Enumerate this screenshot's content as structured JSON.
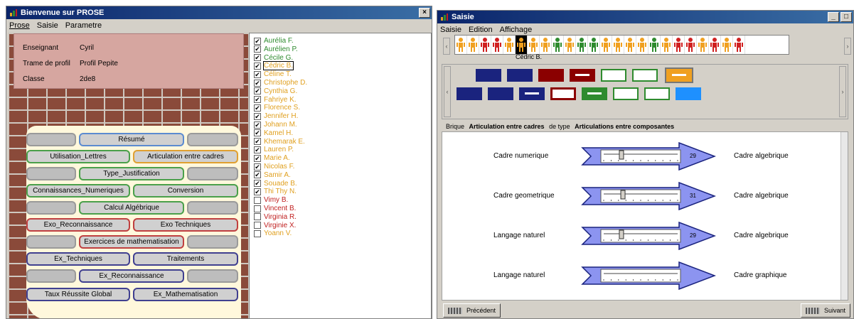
{
  "left_window": {
    "title": "Bienvenue sur PROSE",
    "menu": [
      "Prose",
      "Saisie",
      "Parametre"
    ],
    "info": [
      {
        "label": "Enseignant",
        "value": "Cyril"
      },
      {
        "label": "Trame de profil",
        "value": "Profil Pepite"
      },
      {
        "label": "Classe",
        "value": "2de8"
      }
    ],
    "buttons": {
      "resume": "Résumé",
      "utilisation_lettres": "Utilisation_Lettres",
      "articulation_cadres": "Articulation entre cadres",
      "type_justification": "Type_Justification",
      "connaissances": "Connaissances_Numeriques",
      "conversion": "Conversion",
      "calcul": "Calcul Algébrique",
      "exo_reconnaissance": "Exo_Reconnaissance",
      "exo_techniques": "Exo Techniques",
      "exercices_math": "Exercices de mathematisation",
      "ex_techniques": "Ex_Techniques",
      "traitements": "Traitements",
      "ex_reconnaissance": "Ex_Reconnaissance",
      "taux": "Taux Réussite Global",
      "ex_math": "Ex_Mathematisation"
    },
    "students": [
      {
        "name": "Aurélia F.",
        "checked": true,
        "color": "#2e8b2e"
      },
      {
        "name": "Aurélien P.",
        "checked": true,
        "color": "#2e8b2e"
      },
      {
        "name": "Cécile G.",
        "checked": true,
        "color": "#2e8b2e"
      },
      {
        "name": "Cédric B.",
        "checked": true,
        "color": "#e0a020"
      },
      {
        "name": "Céline T.",
        "checked": true,
        "color": "#e0a020"
      },
      {
        "name": "Christophe D.",
        "checked": true,
        "color": "#e0a020"
      },
      {
        "name": "Cynthia G.",
        "checked": true,
        "color": "#e0a020"
      },
      {
        "name": "Fahriye K.",
        "checked": true,
        "color": "#e0a020"
      },
      {
        "name": "Florence S.",
        "checked": true,
        "color": "#e0a020"
      },
      {
        "name": "Jennifer H.",
        "checked": true,
        "color": "#e0a020"
      },
      {
        "name": "Johann M.",
        "checked": true,
        "color": "#e0a020"
      },
      {
        "name": "Kamel H.",
        "checked": true,
        "color": "#e0a020"
      },
      {
        "name": "Khemarak E.",
        "checked": true,
        "color": "#e0a020"
      },
      {
        "name": "Lauren P.",
        "checked": true,
        "color": "#e0a020"
      },
      {
        "name": "Marie A.",
        "checked": true,
        "color": "#e0a020"
      },
      {
        "name": "Nicolas F.",
        "checked": true,
        "color": "#e0a020"
      },
      {
        "name": "Samir A.",
        "checked": true,
        "color": "#e0a020"
      },
      {
        "name": "Souade B.",
        "checked": true,
        "color": "#e0a020"
      },
      {
        "name": "Thi Thy N.",
        "checked": true,
        "color": "#e0a020"
      },
      {
        "name": "Vimy B.",
        "checked": false,
        "color": "#c02020"
      },
      {
        "name": "Vincent B.",
        "checked": false,
        "color": "#c02020"
      },
      {
        "name": "Virginia R.",
        "checked": false,
        "color": "#c02020"
      },
      {
        "name": "Virginie X.",
        "checked": false,
        "color": "#c02020"
      },
      {
        "name": "Yoann V.",
        "checked": false,
        "color": "#e0a020"
      }
    ]
  },
  "right_window": {
    "title": "Saisie",
    "menu": [
      "Saisie",
      "Edition",
      "Affichage"
    ],
    "selected_student": "Cédric B.",
    "figures": [
      "orange",
      "orange",
      "red",
      "red",
      "orange",
      "selected",
      "orange",
      "orange",
      "green",
      "orange",
      "green",
      "green",
      "orange",
      "orange",
      "orange",
      "orange",
      "green",
      "orange",
      "red",
      "red",
      "orange",
      "red",
      "orange",
      "red"
    ],
    "brique_label": "Brique",
    "brique_value": "Articulation entre cadres",
    "type_label": "de type",
    "type_value": "Articulations entre composantes",
    "rows": [
      {
        "left": "Cadre numerique",
        "value": "29",
        "right": "Cadre algebrique",
        "level": 0.24
      },
      {
        "left": "Cadre geometrique",
        "value": "31",
        "right": "Cadre algebrique",
        "level": 0.26
      },
      {
        "left": "Langage naturel",
        "value": "29",
        "right": "Cadre algebrique",
        "level": 0.24
      },
      {
        "left": "Langage naturel",
        "value": "",
        "right": "Cadre graphique",
        "level": 0
      }
    ],
    "prev_label": "Précédent",
    "next_label": "Suivant"
  }
}
